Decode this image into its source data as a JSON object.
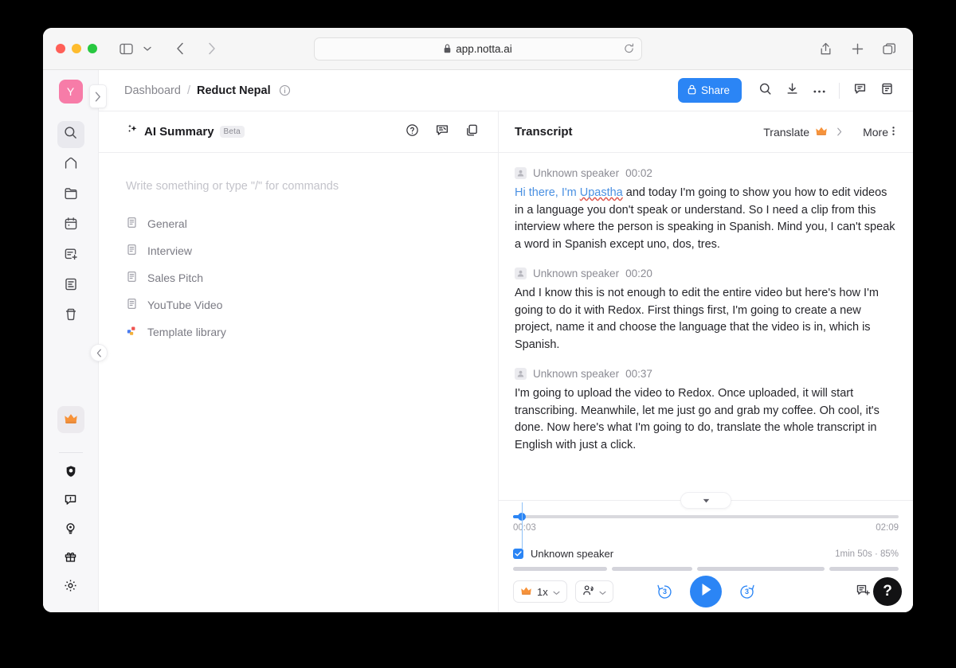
{
  "browser": {
    "url": "app.notta.ai",
    "lock_icon": "lock-icon",
    "reload_icon": "reload-icon",
    "sidebar_toggle_icon": "sidebar-toggle-icon",
    "chevron_down_icon": "chevron-down-icon",
    "back_icon": "back-chevron-icon",
    "forward_icon": "forward-chevron-icon",
    "share_icon": "share-upload-icon",
    "new_tab_icon": "plus-icon",
    "tabs_icon": "tab-overview-icon"
  },
  "rail": {
    "avatar_initial": "Y",
    "items": [
      {
        "name": "search",
        "icon": "search-icon",
        "active": true
      },
      {
        "name": "home",
        "icon": "home-icon",
        "active": false
      },
      {
        "name": "folder",
        "icon": "folder-icon",
        "active": false
      },
      {
        "name": "calendar",
        "icon": "calendar-icon",
        "active": false
      },
      {
        "name": "schedule-add",
        "icon": "calendar-plus-icon",
        "active": false
      },
      {
        "name": "notes",
        "icon": "notes-icon",
        "active": false
      },
      {
        "name": "trash",
        "icon": "trash-icon",
        "active": false
      }
    ],
    "bottom_items": [
      {
        "name": "upgrade",
        "icon": "crown-icon"
      },
      {
        "name": "shield",
        "icon": "shield-icon"
      },
      {
        "name": "feedback",
        "icon": "feedback-icon"
      },
      {
        "name": "whats-new",
        "icon": "lightbulb-icon"
      },
      {
        "name": "gift",
        "icon": "gift-icon"
      },
      {
        "name": "settings",
        "icon": "gear-icon"
      }
    ],
    "expand_icon": "chevron-right-icon"
  },
  "topbar": {
    "breadcrumb_root": "Dashboard",
    "breadcrumb_sep": "/",
    "breadcrumb_current": "Reduct Nepal",
    "info_icon": "info-icon",
    "share_label": "Share",
    "share_lock_icon": "lock-icon",
    "share_color": "#2b85f5",
    "icons": [
      {
        "name": "search",
        "icon": "search-icon"
      },
      {
        "name": "download",
        "icon": "download-icon"
      },
      {
        "name": "more",
        "icon": "more-horizontal-icon"
      },
      {
        "name": "comments",
        "icon": "comment-icon"
      },
      {
        "name": "notes-panel",
        "icon": "notes-icon"
      }
    ]
  },
  "summary_pane": {
    "title": "AI Summary",
    "badge": "Beta",
    "sparkle_icon": "sparkle-icon",
    "actions": [
      {
        "name": "help",
        "icon": "question-circle-icon"
      },
      {
        "name": "feedback",
        "icon": "comment-edit-icon"
      },
      {
        "name": "copy",
        "icon": "copy-icon"
      }
    ],
    "placeholder": "Write something or type \"/\" for commands",
    "templates": [
      {
        "label": "General",
        "icon": "document-icon"
      },
      {
        "label": "Interview",
        "icon": "document-icon"
      },
      {
        "label": "Sales Pitch",
        "icon": "document-icon"
      },
      {
        "label": "YouTube Video",
        "icon": "document-icon"
      },
      {
        "label": "Template library",
        "icon": "template-library-icon"
      }
    ]
  },
  "transcript_pane": {
    "title": "Transcript",
    "translate_label": "Translate",
    "translate_badge_icon": "crown-icon",
    "translate_chevron_icon": "chevron-right-icon",
    "more_label": "More",
    "more_icon": "more-vertical-icon",
    "collapse_icon": "chevron-left-icon",
    "segments": [
      {
        "speaker": "Unknown speaker",
        "time": "00:02",
        "highlight": "Hi there, I'm ",
        "highlight_misspelled": "Upastha",
        "text": " and today I'm going to show you how to edit videos in a language you don't speak or understand. So I need a clip from this interview where the person is speaking in Spanish. Mind you, I can't speak a word in Spanish except uno, dos, tres."
      },
      {
        "speaker": "Unknown speaker",
        "time": "00:20",
        "highlight": "",
        "highlight_misspelled": "",
        "text": "And I know this is not enough to edit the entire video but here's how I'm going to do it with Redox. First things first, I'm going to create a new project, name it and choose the language that the video is in, which is Spanish."
      },
      {
        "speaker": "Unknown speaker",
        "time": "00:37",
        "highlight": "",
        "highlight_misspelled": "",
        "text": "I'm going to upload the video to Redox. Once uploaded, it will start transcribing. Meanwhile, let me just go and grab my coffee. Oh cool, it's done. Now here's what I'm going to do, translate the whole transcript in English with just a click."
      }
    ]
  },
  "player": {
    "collapse_icon": "chevron-down-icon",
    "current_time": "00:03",
    "total_time": "02:09",
    "progress_percent": 2.3,
    "speaker_label": "Unknown speaker",
    "speaker_checked": true,
    "speaker_stats": "1min 50s · 85%",
    "speed_label": "1x",
    "speed_badge_icon": "crown-icon",
    "speed_chevron_icon": "chevron-down-icon",
    "speaker_select_icon": "speaker-person-icon",
    "speaker_select_chevron_icon": "chevron-down-icon",
    "rewind_label": "3",
    "forward_label": "3",
    "rewind_icon": "rewind-3s-icon",
    "forward_icon": "forward-3s-icon",
    "play_icon": "play-icon",
    "add_comment_icon": "add-comment-icon",
    "accent_color": "#2b85f5",
    "waveform_widths": [
      124,
      106,
      168,
      92
    ]
  },
  "help_fab": {
    "label": "?",
    "icon": "question-mark-icon"
  }
}
